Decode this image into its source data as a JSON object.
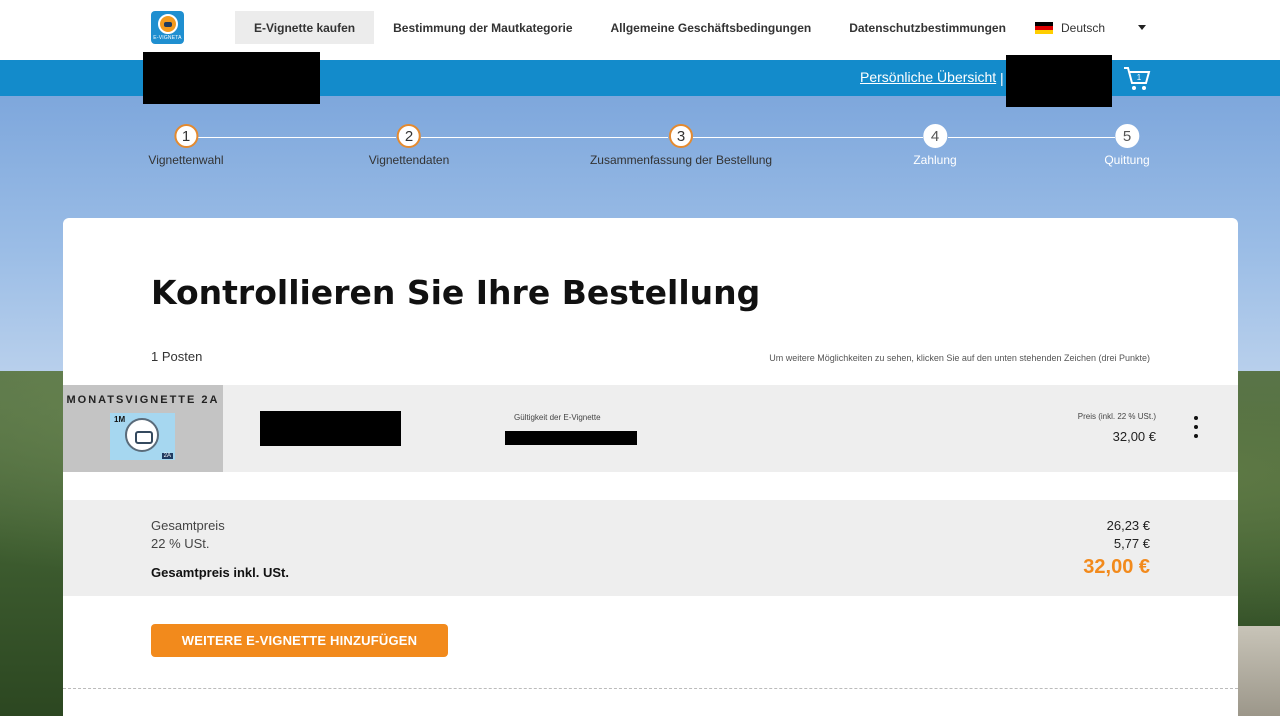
{
  "logo": {
    "text": "E-VIGNETA"
  },
  "nav": {
    "items": [
      {
        "label": "E-Vignette kaufen",
        "active": true
      },
      {
        "label": "Bestimmung der Mautkategorie",
        "active": false
      },
      {
        "label": "Allgemeine Geschäftsbedingungen",
        "active": false
      },
      {
        "label": "Datenschutzbestimmungen",
        "active": false
      }
    ],
    "language": "Deutsch"
  },
  "bluebar": {
    "overview_link": "Persönliche Übersicht",
    "separator": "|",
    "cart_count": "1"
  },
  "stepper": {
    "steps": [
      {
        "num": "1",
        "label": "Vignettenwahl",
        "state": "done"
      },
      {
        "num": "2",
        "label": "Vignettendaten",
        "state": "done"
      },
      {
        "num": "3",
        "label": "Zusammenfassung der Bestellung",
        "state": "current"
      },
      {
        "num": "4",
        "label": "Zahlung",
        "state": "todo"
      },
      {
        "num": "5",
        "label": "Quittung",
        "state": "todo"
      }
    ]
  },
  "main": {
    "title": "Kontrollieren Sie Ihre Bestellung",
    "posten": "1 Posten",
    "hint": "Um weitere Möglichkeiten zu sehen, klicken Sie auf den unten stehenden Zeichen (drei Punkte)",
    "item": {
      "name": "MONATSVIGNETTE 2A",
      "badge_duration": "1M",
      "badge_class": "2A",
      "validity_label": "Gültigkeit der E-Vignette",
      "price_label": "Preis (inkl. 22 % USt.)",
      "price": "32,00 €"
    },
    "totals": {
      "net_label": "Gesamtpreis",
      "net_value": "26,23 €",
      "vat_label": "22 % USt.",
      "vat_value": "5,77 €",
      "gross_label": "Gesamtpreis inkl. USt.",
      "gross_value": "32,00 €"
    },
    "add_button": "WEITERE E-VIGNETTE HINZUFÜGEN"
  },
  "colors": {
    "brand_blue": "#138bcb",
    "accent_orange": "#f28a1c"
  }
}
